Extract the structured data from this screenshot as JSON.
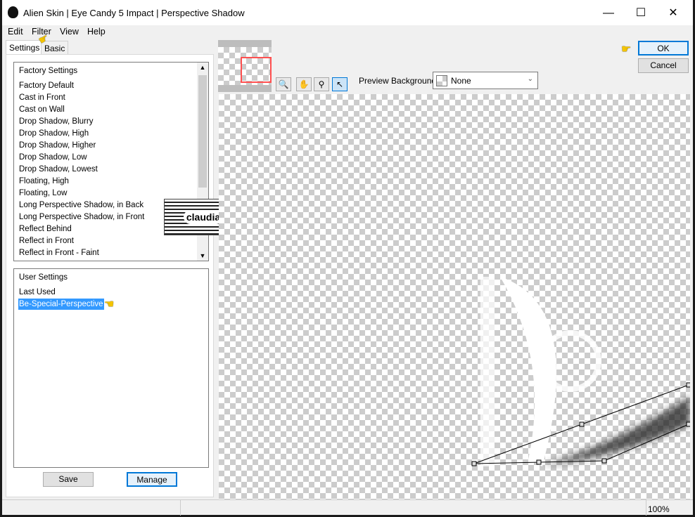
{
  "window": {
    "title": "Alien Skin | Eye Candy 5 Impact | Perspective Shadow",
    "minimize": "—",
    "maximize": "☐",
    "close": "✕"
  },
  "menu": [
    "Edit",
    "Filter",
    "View",
    "Help"
  ],
  "tabs": [
    {
      "label": "Settings",
      "active": true
    },
    {
      "label": "Basic",
      "active": false
    }
  ],
  "factory": {
    "header": "Factory Settings",
    "items": [
      "Factory Default",
      "Cast in Front",
      "Cast on Wall",
      "Drop Shadow, Blurry",
      "Drop Shadow, High",
      "Drop Shadow, Higher",
      "Drop Shadow, Low",
      "Drop Shadow, Lowest",
      "Floating, High",
      "Floating, Low",
      "Long Perspective Shadow, in Back",
      "Long Perspective Shadow, in Front",
      "Reflect Behind",
      "Reflect in Front",
      "Reflect in Front - Faint"
    ]
  },
  "user": {
    "header": "User Settings",
    "items": [
      "Last Used",
      "Be-Special-Perspective"
    ],
    "selected": "Be-Special-Perspective"
  },
  "buttons": {
    "save": "Save",
    "manage": "Manage",
    "ok": "OK",
    "cancel": "Cancel"
  },
  "preview": {
    "background_label": "Preview Background:",
    "background_value": "None"
  },
  "tools": [
    "navigator-icon",
    "hand-icon",
    "zoom-icon",
    "pointer-icon"
  ],
  "status": {
    "zoom": "100%"
  },
  "watermark": "claudia",
  "colors": {
    "selection": "#3399ff",
    "ok_border": "#0078d7",
    "thumb_frame": "#ff5050"
  }
}
